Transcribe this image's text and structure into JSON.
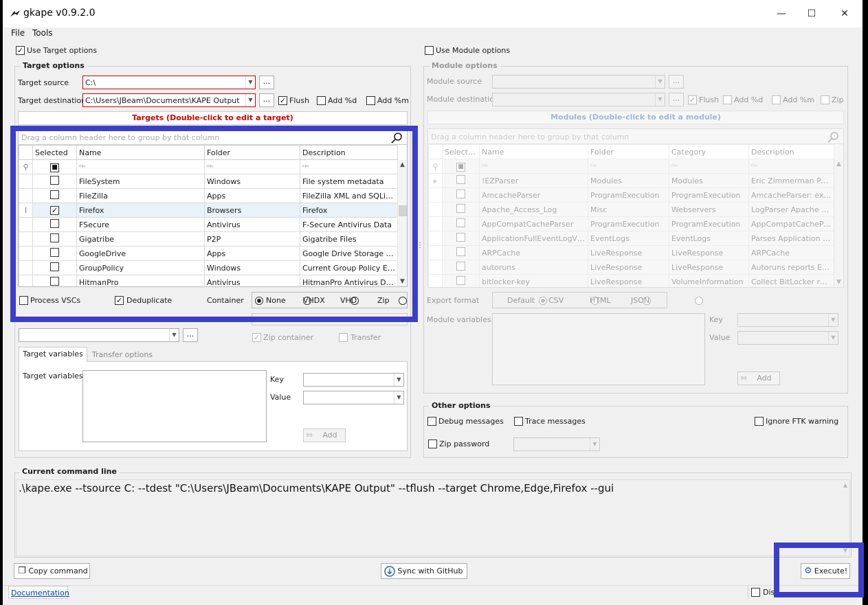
{
  "window": {
    "title": "gkape v0.9.2.0",
    "minimize": "—",
    "maximize": "☐",
    "close": "✕"
  },
  "menu": {
    "file": "File",
    "tools": "Tools"
  },
  "target": {
    "use_label": "Use Target options",
    "group_title": "Target options",
    "source_label": "Target source",
    "source_value": "C:\\",
    "dest_label": "Target destination",
    "dest_value": "C:\\Users\\JBeam\\Documents\\KAPE Output",
    "browse": "...",
    "flush": "Flush",
    "add_d": "Add %d",
    "add_m": "Add %m",
    "targets_title": "Targets (Double-click to edit a target)",
    "group_panel": "Drag a column header here to group by that column",
    "columns": [
      "Selected",
      "Name",
      "Folder",
      "Description"
    ],
    "filter_glyph": "ᴿᴮᶜ",
    "rows": [
      {
        "name": "FileSystem",
        "folder": "Windows",
        "description": "File system metadata",
        "checked": ""
      },
      {
        "name": "FileZilla",
        "folder": "Apps",
        "description": "FileZilla XML and SQLite Lo...",
        "checked": ""
      },
      {
        "name": "Firefox",
        "folder": "Browsers",
        "description": "Firefox",
        "checked": "✓"
      },
      {
        "name": "FSecure",
        "folder": "Antivirus",
        "description": "F-Secure Antivirus Data",
        "checked": ""
      },
      {
        "name": "Gigatribe",
        "folder": "P2P",
        "description": "Gigatribe Files",
        "checked": ""
      },
      {
        "name": "GoogleDrive",
        "folder": "Apps",
        "description": "Google Drive Storage File...",
        "checked": ""
      },
      {
        "name": "GroupPolicy",
        "folder": "Windows",
        "description": "Current Group Policy Enfo...",
        "checked": ""
      },
      {
        "name": "HitmanPro",
        "folder": "Antivirus",
        "description": "HitmanPro Antivirus Data",
        "checked": ""
      }
    ],
    "process_vsc": "Process VSCs",
    "deduplicate": "Deduplicate",
    "container_label": "Container",
    "container_options": [
      "None",
      "VHDX",
      "VHD",
      "Zip"
    ],
    "zip_container": "Zip container",
    "transfer": "Transfer",
    "tabs": [
      "Target variables",
      "Transfer options"
    ],
    "vars_label": "Target variables",
    "key": "Key",
    "value": "Value",
    "add": "Add"
  },
  "module": {
    "use_label": "Use Module options",
    "group_title": "Module options",
    "source_label": "Module source",
    "dest_label": "Module destination",
    "browse": "...",
    "flush": "Flush",
    "add_d": "Add %d",
    "add_m": "Add %m",
    "zip": "Zip",
    "modules_title": "Modules (Double-click to edit a module)",
    "group_panel": "Drag a column header here to group by that column",
    "columns": [
      "Selected",
      "Name",
      "Folder",
      "Category",
      "Description"
    ],
    "filter_glyph": "ᴿᴮᶜ",
    "rows": [
      {
        "name": "!EZParser",
        "folder": "Modules",
        "category": "Modules",
        "description": "Eric Zimmerman Parsers"
      },
      {
        "name": "AmcacheParser",
        "folder": "ProgramExecution",
        "category": "ProgramExecution",
        "description": "AmcacheParser: extr..."
      },
      {
        "name": "Apache_Access_Log",
        "folder": "Misc",
        "category": "Webservers",
        "description": "LogParser Apache Ac..."
      },
      {
        "name": "AppCompatCacheParser",
        "folder": "ProgramExecution",
        "category": "ProgramExecution",
        "description": "AppCompatCachePar..."
      },
      {
        "name": "ApplicationFullEventLogView",
        "folder": "EventLogs",
        "category": "EventLogs",
        "description": "Parses Application ev..."
      },
      {
        "name": "ARPCache",
        "folder": "LiveResponse",
        "category": "LiveResponse",
        "description": "ARPCache"
      },
      {
        "name": "autoruns",
        "folder": "LiveResponse",
        "category": "LiveResponse",
        "description": "Autoruns reports Exp..."
      },
      {
        "name": "bitlocker-key",
        "folder": "LiveResponse",
        "category": "VolumeInformation",
        "description": "Collect BitLocker reco..."
      }
    ],
    "export_label": "Export format",
    "export_options": [
      "Default",
      "CSV",
      "HTML",
      "JSON"
    ],
    "vars_label": "Module variables",
    "key": "Key",
    "value": "Value",
    "add": "Add"
  },
  "other": {
    "title": "Other options",
    "debug": "Debug messages",
    "trace": "Trace messages",
    "ignore_ftk": "Ignore FTK warning",
    "zip_password": "Zip password"
  },
  "command": {
    "title": "Current command line",
    "text": ".\\kape.exe --tsource C: --tdest \"C:\\Users\\JBeam\\Documents\\KAPE Output\" --tflush --target Chrome,Edge,Firefox --gui"
  },
  "bottom": {
    "copy": "Copy command",
    "sync": "Sync with GitHub",
    "execute": "Execute!",
    "documentation": "Documentation",
    "disable_flush": "Dis"
  },
  "colors": {
    "accent_red": "#d40000",
    "highlight": "#3d3ec7",
    "module_title": "#9cb8d8"
  }
}
